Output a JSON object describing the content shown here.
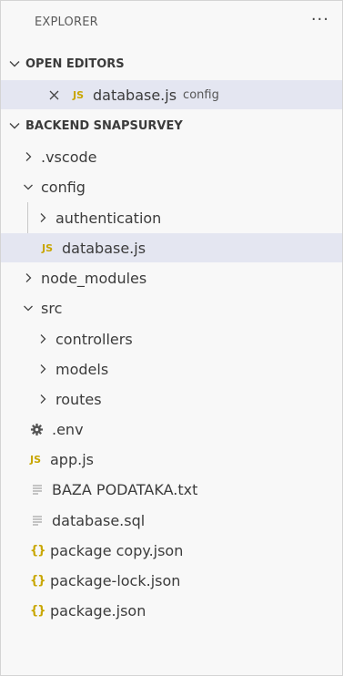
{
  "explorer": {
    "title": "EXPLORER",
    "more": "···"
  },
  "open_editors": {
    "header": "OPEN EDITORS",
    "items": [
      {
        "icon": "JS",
        "name": "database.js",
        "description": "config"
      }
    ]
  },
  "project": {
    "header": "BACKEND SNAPSURVEY",
    "tree": {
      "vscode": ".vscode",
      "config": "config",
      "authentication": "authentication",
      "database_js": "database.js",
      "node_modules": "node_modules",
      "src": "src",
      "controllers": "controllers",
      "models": "models",
      "routes": "routes",
      "env": ".env",
      "app_js": "app.js",
      "baza": "BAZA PODATAKA.txt",
      "database_sql": "database.sql",
      "package_copy": "package copy.json",
      "package_lock": "package-lock.json",
      "package_json": "package.json"
    }
  },
  "icons": {
    "js": "JS",
    "json": "{}"
  },
  "colors": {
    "selection": "#e4e6f1",
    "js_accent": "#c8a600"
  }
}
